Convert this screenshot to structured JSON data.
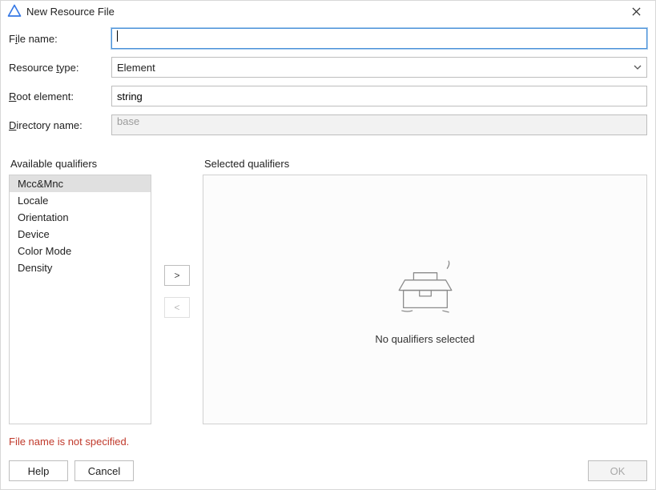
{
  "titlebar": {
    "title": "New Resource File"
  },
  "form": {
    "file_name": {
      "label_pre": "F",
      "label_u": "i",
      "label_post": "le name:",
      "value": "",
      "placeholder": ""
    },
    "resource_type": {
      "label_pre": "Resource ",
      "label_u": "t",
      "label_post": "ype:",
      "value": "Element"
    },
    "root_element": {
      "label_pre": "",
      "label_u": "R",
      "label_post": "oot element:",
      "value": "string"
    },
    "directory_name": {
      "label_pre": "",
      "label_u": "D",
      "label_post": "irectory name:",
      "value": "base"
    }
  },
  "qualifiers": {
    "available_title": "Available qualifiers",
    "selected_title": "Selected qualifiers",
    "available": [
      "Mcc&Mnc",
      "Locale",
      "Orientation",
      "Device",
      "Color Mode",
      "Density"
    ],
    "selected_empty_msg": "No qualifiers selected",
    "move_right": ">",
    "move_left": "<"
  },
  "error": "File name is not specified.",
  "buttons": {
    "help": "Help",
    "cancel": "Cancel",
    "ok": "OK"
  }
}
